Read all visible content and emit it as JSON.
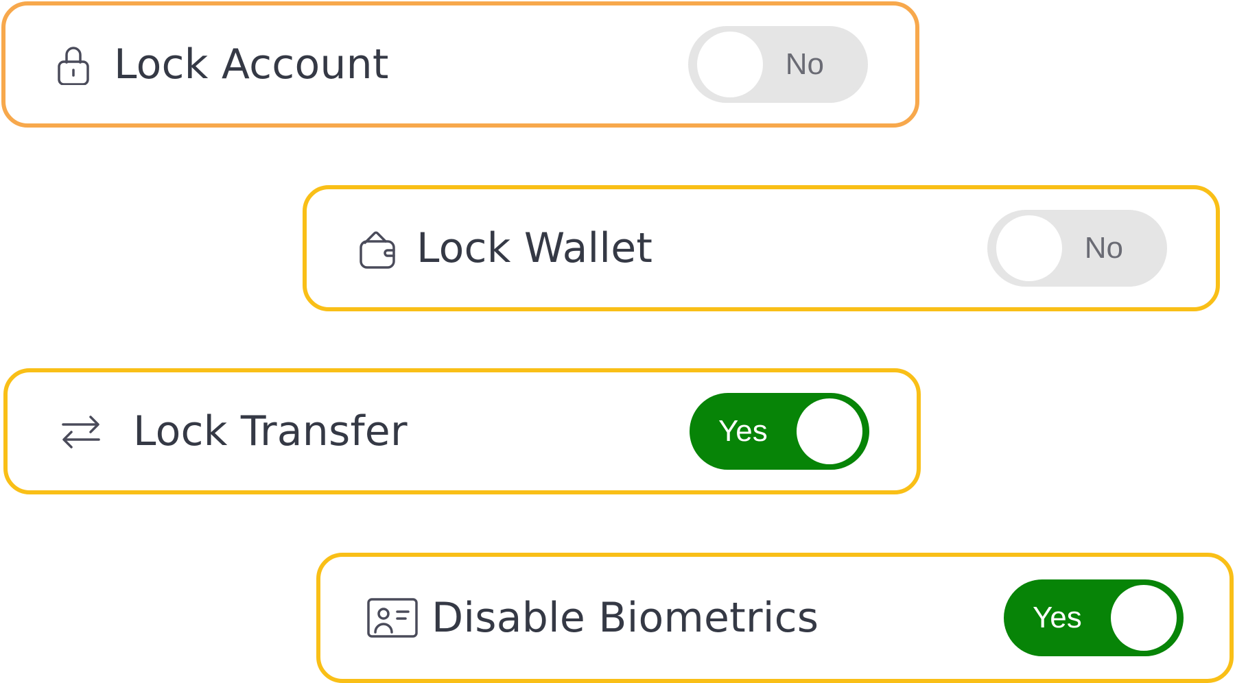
{
  "settings": {
    "items": [
      {
        "id": "lock-account",
        "label": "Lock Account",
        "icon": "lock-icon",
        "state": "No",
        "enabled": false
      },
      {
        "id": "lock-wallet",
        "label": "Lock Wallet",
        "icon": "wallet-icon",
        "state": "No",
        "enabled": false
      },
      {
        "id": "lock-transfer",
        "label": "Lock Transfer",
        "icon": "transfer-arrows-icon",
        "state": "Yes",
        "enabled": true
      },
      {
        "id": "disable-biometrics",
        "label": "Disable Biometrics",
        "icon": "id-card-icon",
        "state": "Yes",
        "enabled": true
      }
    ]
  },
  "colors": {
    "card_border_orange": "#f7a84c",
    "card_border_yellow": "#f9bf17",
    "toggle_on": "#078407",
    "toggle_off": "#e5e5e5",
    "label_text": "#353945",
    "icon_stroke": "#4a4b5a"
  }
}
